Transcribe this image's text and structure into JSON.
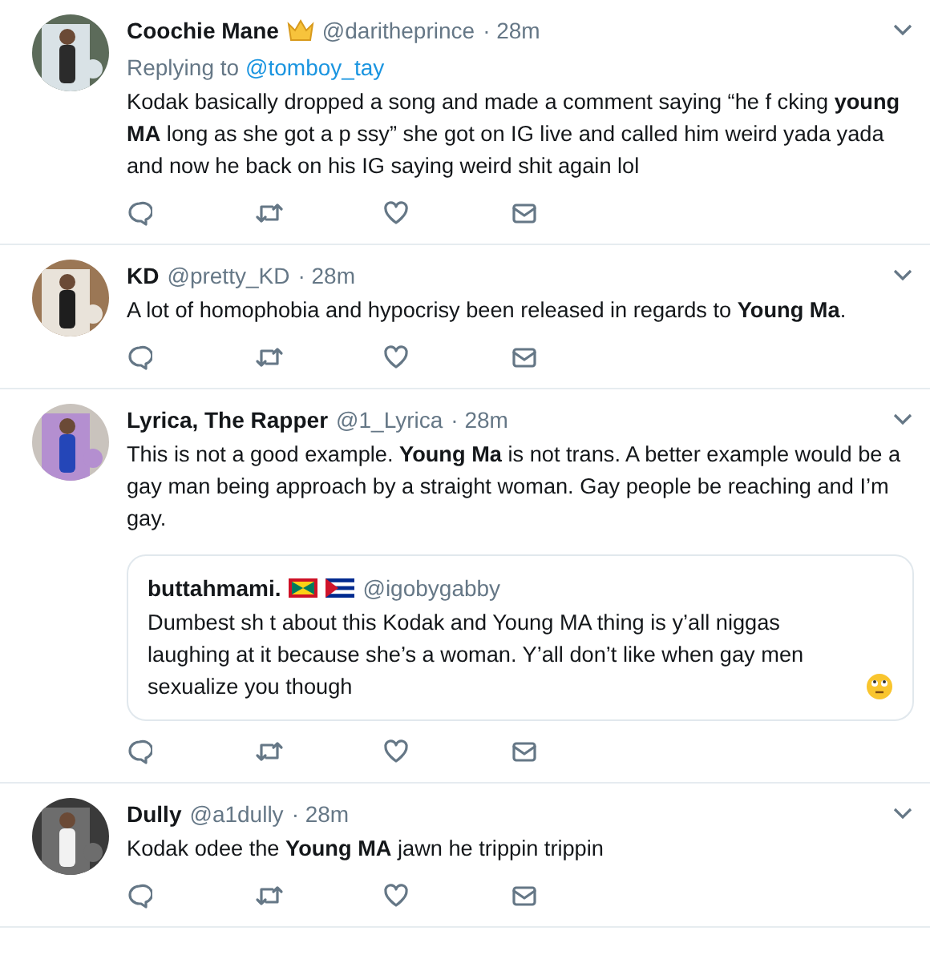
{
  "tweets": [
    {
      "name": "Coochie Mane",
      "badges": [
        {
          "kind": "crown"
        }
      ],
      "handle": "@daritheprince",
      "time": "· 28m",
      "avatar": {
        "kind": "picture"
      },
      "reply_to": {
        "label": "Replying to",
        "user": "@tomboy_tay"
      },
      "text": "Kodak basically dropped a song and made a comment saying “he f  cking **young MA** long as she got a p  ssy” she got on IG live and called him weird yada yada and now he back on his IG saying weird shit again lol"
    },
    {
      "name": "KD",
      "handle": "@pretty_KD",
      "time": "· 28m",
      "avatar": {
        "kind": "picture"
      },
      "text": "A lot of homophobia and hypocrisy been released in regards to **Young Ma**."
    },
    {
      "name": "Lyrica, The Rapper",
      "handle": "@1_Lyrica",
      "time": "· 28m",
      "avatar": {
        "kind": "picture"
      },
      "text": "This is not a good example. **Young Ma** is not trans. A better example would be a gay man being approach by a straight woman. Gay people be reaching and I’m gay.",
      "quote": {
        "name": "buttahmami.",
        "badges": [
          {
            "kind": "flag-green"
          },
          {
            "kind": "flag-blue"
          }
        ],
        "handle": "@igobygabby",
        "text": "Dumbest sh  t about this Kodak and Young MA thing is y’all niggas laughing at it because she’s a woman. Y’all don’t like when gay men sexualize you though",
        "trailing_emoji": {
          "kind": "face"
        }
      }
    },
    {
      "name": "Dully",
      "handle": "@a1dully",
      "time": "· 28m",
      "avatar": {
        "kind": "picture"
      },
      "text": "Kodak odee the **Young MA** jawn he trippin trippin"
    }
  ]
}
